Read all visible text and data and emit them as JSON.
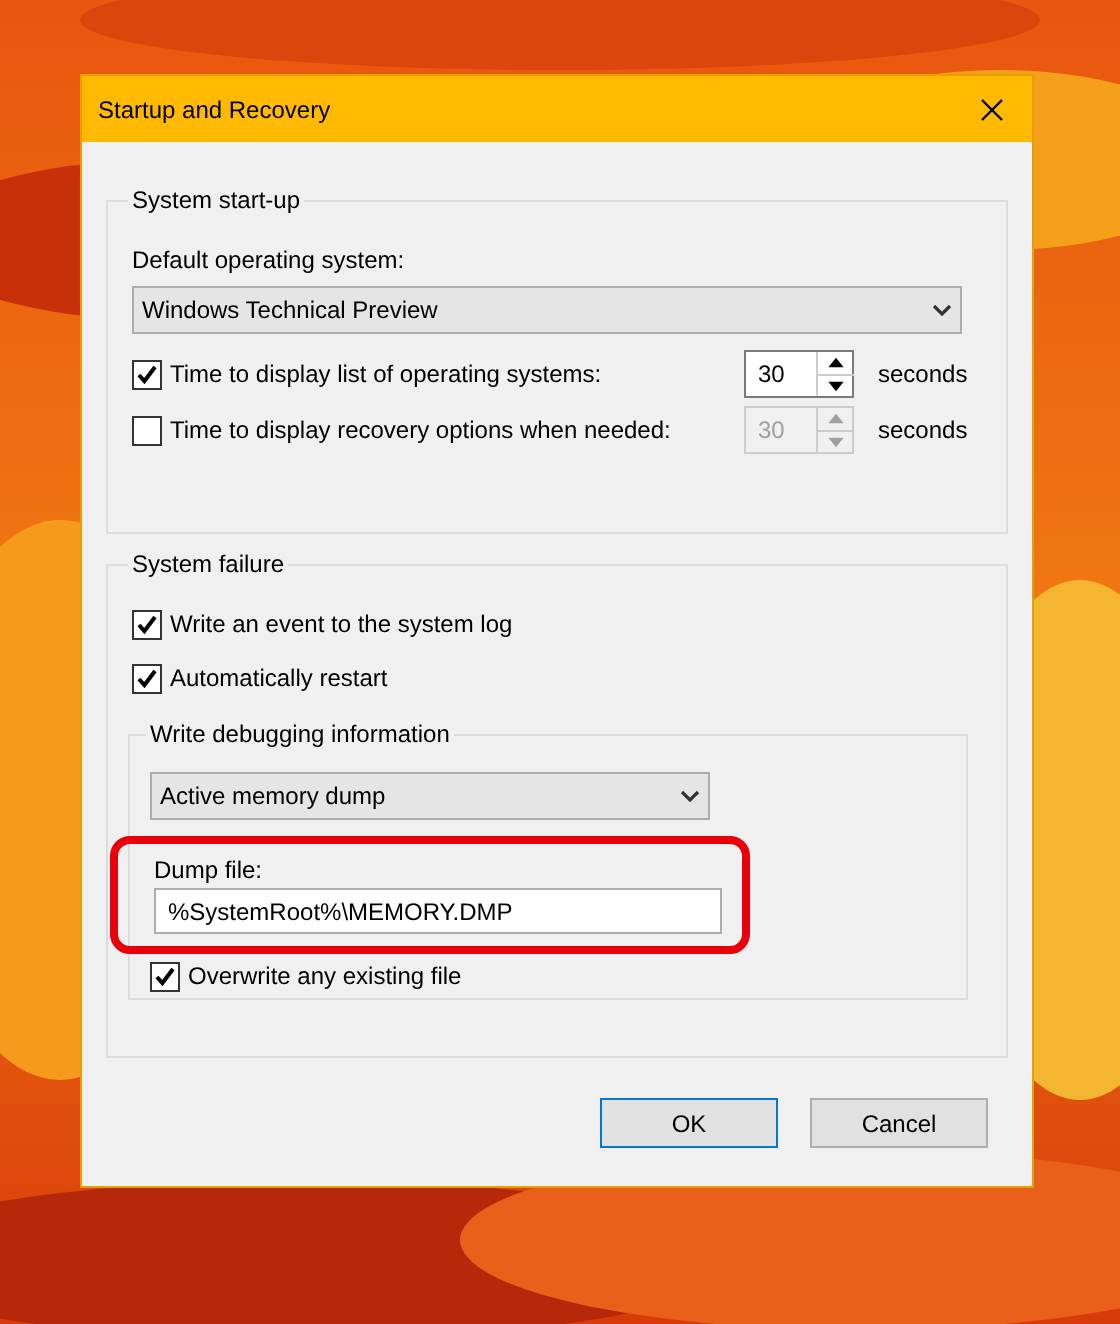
{
  "window": {
    "title": "Startup and Recovery"
  },
  "system_startup": {
    "title": "System start-up",
    "default_os_label": "Default operating system:",
    "default_os": "Windows Technical Preview",
    "options": [
      {
        "label": "Time to display list of operating systems:",
        "checked": true,
        "value": "30",
        "disabled": false,
        "unit": "seconds"
      },
      {
        "label": "Time to display recovery options when needed:",
        "checked": false,
        "value": "30",
        "disabled": true,
        "unit": "seconds"
      }
    ]
  },
  "system_failure": {
    "title": "System failure",
    "options": [
      {
        "label": "Write an event to the system log",
        "checked": true
      },
      {
        "label": "Automatically restart",
        "checked": true
      }
    ],
    "debugging": {
      "title": "Write debugging information",
      "dump_type": "Active memory dump",
      "dump_file_label": "Dump file:",
      "dump_file": "%SystemRoot%\\MEMORY.DMP",
      "highlighted": true,
      "overwrite": {
        "label": "Overwrite any existing file",
        "checked": true
      }
    }
  },
  "buttons": [
    {
      "label": "OK",
      "selected": true
    },
    {
      "label": "Cancel",
      "selected": false
    }
  ]
}
